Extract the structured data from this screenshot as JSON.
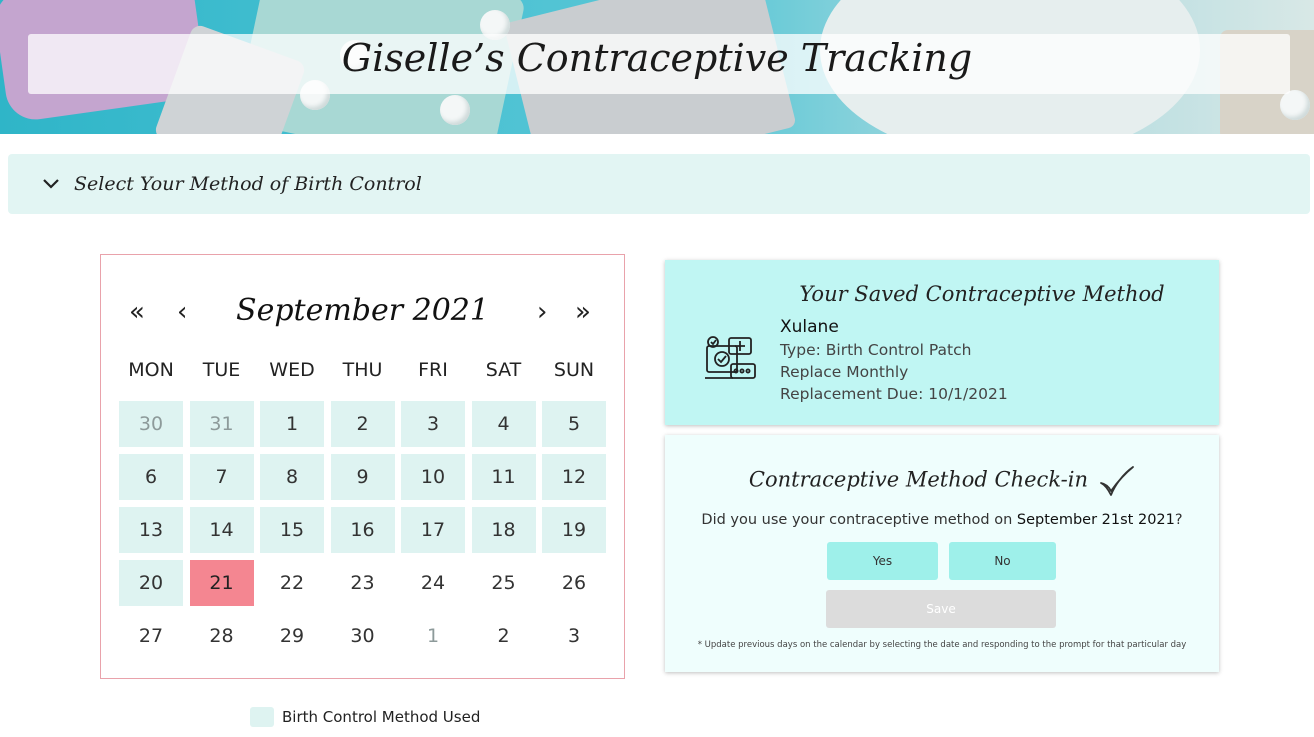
{
  "header": {
    "title": "Giselle’s Contraceptive Tracking"
  },
  "accordion": {
    "label": "Select Your Method of Birth Control",
    "icon": "chevron-down-icon"
  },
  "calendar": {
    "month_label": "September 2021",
    "nav": {
      "prev_year": "«",
      "prev_month": "‹",
      "next_month": "›",
      "next_year": "»"
    },
    "weekdays": [
      "MON",
      "TUE",
      "WED",
      "THU",
      "FRI",
      "SAT",
      "SUN"
    ],
    "days": [
      {
        "label": "30",
        "used": true,
        "other_month": true,
        "selected": false
      },
      {
        "label": "31",
        "used": true,
        "other_month": true,
        "selected": false
      },
      {
        "label": "1",
        "used": true,
        "other_month": false,
        "selected": false
      },
      {
        "label": "2",
        "used": true,
        "other_month": false,
        "selected": false
      },
      {
        "label": "3",
        "used": true,
        "other_month": false,
        "selected": false
      },
      {
        "label": "4",
        "used": true,
        "other_month": false,
        "selected": false
      },
      {
        "label": "5",
        "used": true,
        "other_month": false,
        "selected": false
      },
      {
        "label": "6",
        "used": true,
        "other_month": false,
        "selected": false
      },
      {
        "label": "7",
        "used": true,
        "other_month": false,
        "selected": false
      },
      {
        "label": "8",
        "used": true,
        "other_month": false,
        "selected": false
      },
      {
        "label": "9",
        "used": true,
        "other_month": false,
        "selected": false
      },
      {
        "label": "10",
        "used": true,
        "other_month": false,
        "selected": false
      },
      {
        "label": "11",
        "used": true,
        "other_month": false,
        "selected": false
      },
      {
        "label": "12",
        "used": true,
        "other_month": false,
        "selected": false
      },
      {
        "label": "13",
        "used": true,
        "other_month": false,
        "selected": false
      },
      {
        "label": "14",
        "used": true,
        "other_month": false,
        "selected": false
      },
      {
        "label": "15",
        "used": true,
        "other_month": false,
        "selected": false
      },
      {
        "label": "16",
        "used": true,
        "other_month": false,
        "selected": false
      },
      {
        "label": "17",
        "used": true,
        "other_month": false,
        "selected": false
      },
      {
        "label": "18",
        "used": true,
        "other_month": false,
        "selected": false
      },
      {
        "label": "19",
        "used": true,
        "other_month": false,
        "selected": false
      },
      {
        "label": "20",
        "used": true,
        "other_month": false,
        "selected": false
      },
      {
        "label": "21",
        "used": false,
        "other_month": false,
        "selected": true
      },
      {
        "label": "22",
        "used": false,
        "other_month": false,
        "selected": false
      },
      {
        "label": "23",
        "used": false,
        "other_month": false,
        "selected": false
      },
      {
        "label": "24",
        "used": false,
        "other_month": false,
        "selected": false
      },
      {
        "label": "25",
        "used": false,
        "other_month": false,
        "selected": false
      },
      {
        "label": "26",
        "used": false,
        "other_month": false,
        "selected": false
      },
      {
        "label": "27",
        "used": false,
        "other_month": false,
        "selected": false
      },
      {
        "label": "28",
        "used": false,
        "other_month": false,
        "selected": false
      },
      {
        "label": "29",
        "used": false,
        "other_month": false,
        "selected": false
      },
      {
        "label": "30",
        "used": false,
        "other_month": false,
        "selected": false
      },
      {
        "label": "1",
        "used": false,
        "other_month": true,
        "selected": false
      },
      {
        "label": "2",
        "used": false,
        "other_month": false,
        "selected": false
      },
      {
        "label": "3",
        "used": false,
        "other_month": false,
        "selected": false
      }
    ],
    "legend_label": "Birth Control Method Used"
  },
  "saved_method": {
    "title": "Your Saved Contraceptive Method",
    "name": "Xulane",
    "type": "Type: Birth Control Patch",
    "frequency": "Replace Monthly",
    "due": "Replacement Due: 10/1/2021",
    "icon": "contraceptive-kit-icon"
  },
  "checkin": {
    "title": "Contraceptive Method Check-in",
    "question_prefix": "Did you use your contraceptive method on ",
    "question_date": "September 21st 2021",
    "question_suffix": "?",
    "yes_label": "Yes",
    "no_label": "No",
    "save_label": "Save",
    "note": "* Update previous days on the calendar by selecting the date and responding to the prompt for that particular day"
  },
  "colors": {
    "used_day": "#def3f1",
    "selected_day": "#f48691",
    "calendar_border": "#e9a2ab",
    "saved_card": "#c0f6f3",
    "checkin_card": "#effefd",
    "button": "#9ef0ea",
    "disabled_button": "#dcdcdc"
  }
}
